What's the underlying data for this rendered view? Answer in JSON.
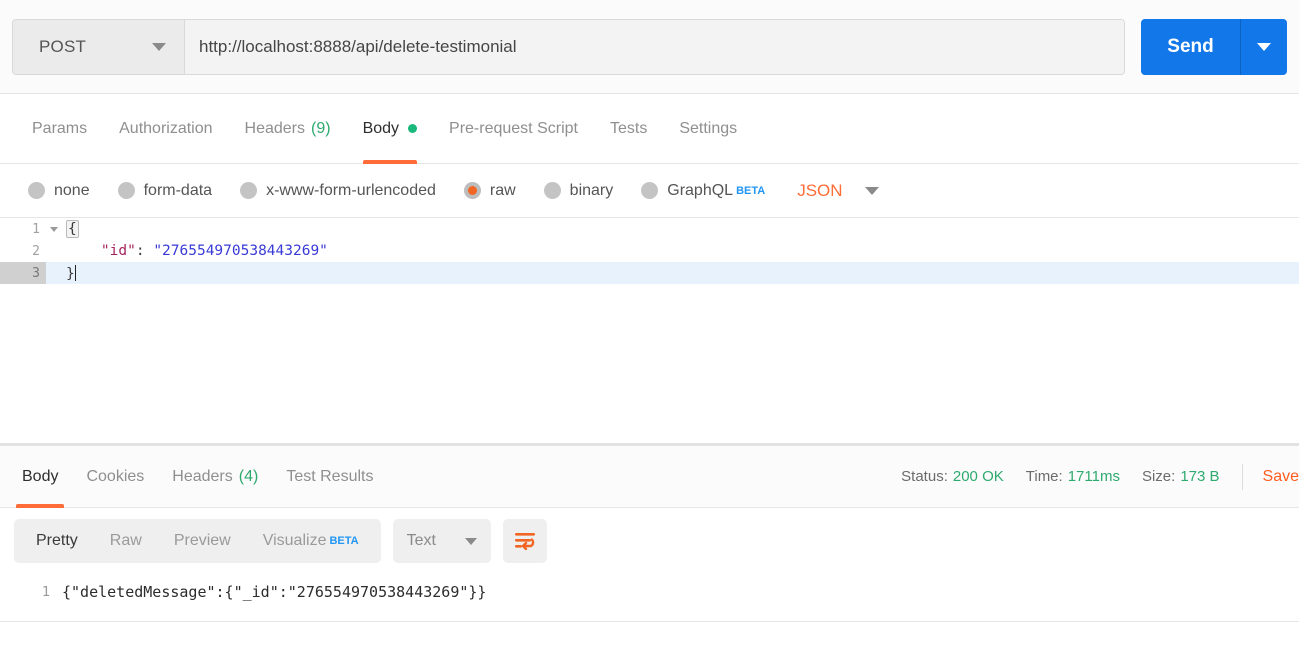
{
  "request": {
    "method": "POST",
    "url": "http://localhost:8888/api/delete-testimonial",
    "send_label": "Send",
    "tabs": [
      {
        "label": "Params",
        "active": false
      },
      {
        "label": "Authorization",
        "active": false
      },
      {
        "label": "Headers",
        "count": "(9)",
        "active": false
      },
      {
        "label": "Body",
        "active": true,
        "dot": true
      },
      {
        "label": "Pre-request Script",
        "active": false
      },
      {
        "label": "Tests",
        "active": false
      },
      {
        "label": "Settings",
        "active": false
      }
    ],
    "body_types": [
      {
        "label": "none",
        "selected": false
      },
      {
        "label": "form-data",
        "selected": false
      },
      {
        "label": "x-www-form-urlencoded",
        "selected": false
      },
      {
        "label": "raw",
        "selected": true
      },
      {
        "label": "binary",
        "selected": false
      },
      {
        "label": "GraphQL",
        "selected": false,
        "badge": "BETA"
      }
    ],
    "content_type": "JSON",
    "editor": {
      "lines": [
        {
          "num": "1",
          "foldable": true,
          "text": "{"
        },
        {
          "num": "2",
          "foldable": false,
          "key": "\"id\"",
          "colon": ": ",
          "value": "\"276554970538443269\""
        },
        {
          "num": "3",
          "foldable": false,
          "text": "}",
          "highlighted": true
        }
      ]
    }
  },
  "response": {
    "tabs": [
      {
        "label": "Body",
        "active": true
      },
      {
        "label": "Cookies",
        "active": false
      },
      {
        "label": "Headers",
        "count": "(4)",
        "active": false
      },
      {
        "label": "Test Results",
        "active": false
      }
    ],
    "meta": {
      "status_label": "Status:",
      "status_value": "200 OK",
      "time_label": "Time:",
      "time_value": "1711ms",
      "size_label": "Size:",
      "size_value": "173 B",
      "save_label": "Save"
    },
    "view_modes": [
      {
        "label": "Pretty",
        "active": true
      },
      {
        "label": "Raw",
        "active": false
      },
      {
        "label": "Preview",
        "active": false
      },
      {
        "label": "Visualize",
        "active": false,
        "badge": "BETA"
      }
    ],
    "format": "Text",
    "wrap_icon": "word-wrap-icon",
    "body": {
      "line_number": "1",
      "text": "{\"deletedMessage\":{\"_id\":\"276554970538443269\"}}"
    }
  },
  "colors": {
    "accent_orange": "#ff6c37",
    "send_blue": "#1277e8",
    "success_green": "#2eaa6e",
    "beta_blue": "#2196f3"
  }
}
